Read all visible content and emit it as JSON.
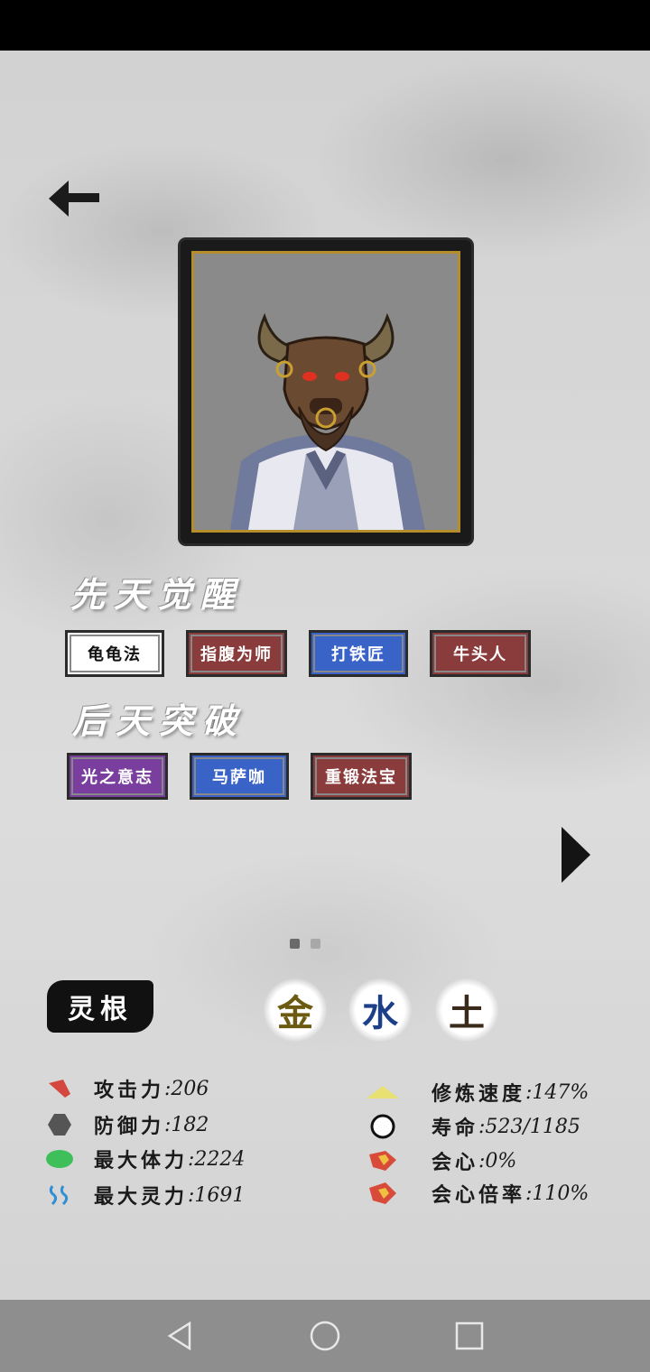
{
  "nav": {
    "back_icon": "arrow-left-icon",
    "next_icon": "triangle-right-icon"
  },
  "portrait": {
    "subject": "ox-headed cultivator portrait"
  },
  "innate": {
    "title": "先天觉醒",
    "chips": [
      {
        "label": "龟龟法",
        "color": "white"
      },
      {
        "label": "指腹为师",
        "color": "red"
      },
      {
        "label": "打铁匠",
        "color": "blue"
      },
      {
        "label": "牛头人",
        "color": "red"
      }
    ]
  },
  "acquired": {
    "title": "后天突破",
    "chips": [
      {
        "label": "光之意志",
        "color": "purple"
      },
      {
        "label": "马萨咖",
        "color": "blue"
      },
      {
        "label": "重锻法宝",
        "color": "red"
      }
    ]
  },
  "pager": {
    "current": 1,
    "total": 2
  },
  "lingen": {
    "label": "灵根",
    "elements": [
      {
        "char": "金",
        "color": "#6b5a10"
      },
      {
        "char": "水",
        "color": "#1c3f8a"
      },
      {
        "char": "土",
        "color": "#3a2a1a"
      }
    ]
  },
  "stats_left": [
    {
      "icon": "attack-icon",
      "label": "攻击力",
      "value": ":206"
    },
    {
      "icon": "defense-icon",
      "label": "防御力",
      "value": ":182"
    },
    {
      "icon": "hp-icon",
      "label": "最大体力",
      "value": ":2224"
    },
    {
      "icon": "mana-icon",
      "label": "最大灵力",
      "value": ":1691"
    }
  ],
  "stats_right": [
    {
      "icon": "cultivation-speed-icon",
      "label": "修炼速度",
      "value": ":147%"
    },
    {
      "icon": "lifespan-icon",
      "label": "寿命",
      "value": ":523/1185"
    },
    {
      "icon": "crit-icon",
      "label": "会心",
      "value": ":0%"
    },
    {
      "icon": "crit-multiplier-icon",
      "label": "会心倍率",
      "value": ":110%"
    }
  ],
  "system_nav": {
    "back_icon": "nav-back-icon",
    "home_icon": "nav-home-icon",
    "recents_icon": "nav-recents-icon"
  },
  "colors": {
    "chip_red": "#8a3b3b",
    "chip_blue": "#3a63c8",
    "chip_purple": "#7a3f9e",
    "frame_gold": "#b58d2a"
  }
}
